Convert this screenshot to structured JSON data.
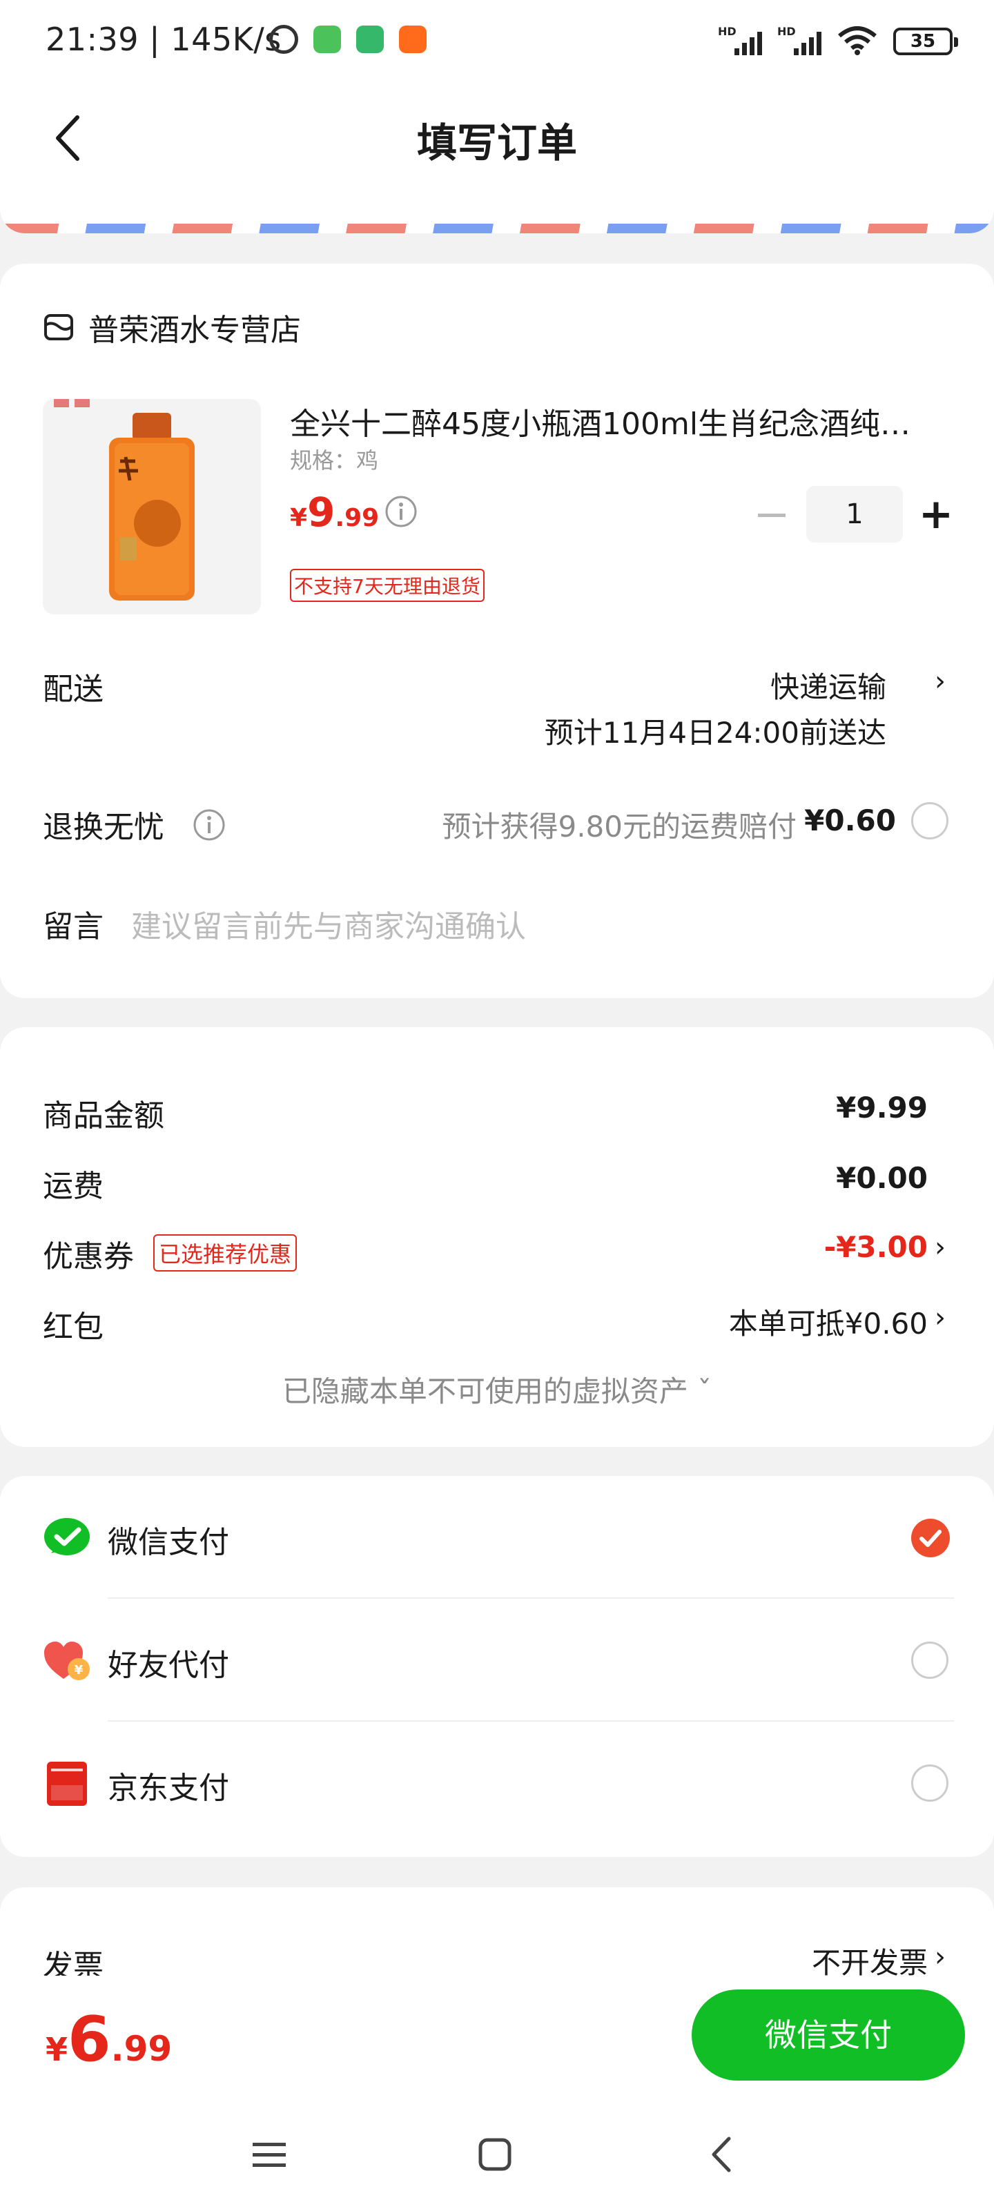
{
  "status_bar": {
    "time": "21:39 | 145K/s",
    "hd_label": "HD",
    "battery": "35"
  },
  "header": {
    "title": "填写订单"
  },
  "shop": {
    "name": "普荣酒水专营店"
  },
  "product": {
    "title": "全兴十二醉45度小瓶酒100ml生肖纪念酒纯…",
    "spec": "规格：鸡",
    "price_symbol": "¥",
    "price_int": "9",
    "price_dec": ".99",
    "quantity": "1",
    "return_policy": "不支持7天无理由退货"
  },
  "delivery": {
    "label": "配送",
    "method": "快递运输",
    "eta": "预计11月4日24:00前送达"
  },
  "return_worry_free": {
    "label": "退换无忧",
    "desc": "预计获得9.80元的运费赔付",
    "price": "¥0.60"
  },
  "message": {
    "label": "留言",
    "placeholder": "建议留言前先与商家沟通确认"
  },
  "summary": {
    "goods_label": "商品金额",
    "goods_value": "¥9.99",
    "shipping_label": "运费",
    "shipping_value": "¥0.00",
    "coupon_label": "优惠券",
    "coupon_badge": "已选推荐优惠",
    "coupon_value": "-¥3.00",
    "redpacket_label": "红包",
    "redpacket_value": "本单可抵¥0.60",
    "hidden_note": "已隐藏本单不可使用的虚拟资产 ˇ"
  },
  "payment_methods": [
    {
      "label": "微信支付",
      "selected": true,
      "icon": "wechat-pay-icon"
    },
    {
      "label": "好友代付",
      "selected": false,
      "icon": "friend-pay-icon"
    },
    {
      "label": "京东支付",
      "selected": false,
      "icon": "jd-pay-icon"
    }
  ],
  "invoice": {
    "label": "发票",
    "value": "不开发票"
  },
  "footer": {
    "total_symbol": "¥",
    "total_int": "6",
    "total_dec": ".99",
    "pay_button": "微信支付"
  },
  "colors": {
    "accent_red": "#e4261b",
    "pay_green": "#11be25",
    "check_orange": "#ee4d2d"
  }
}
